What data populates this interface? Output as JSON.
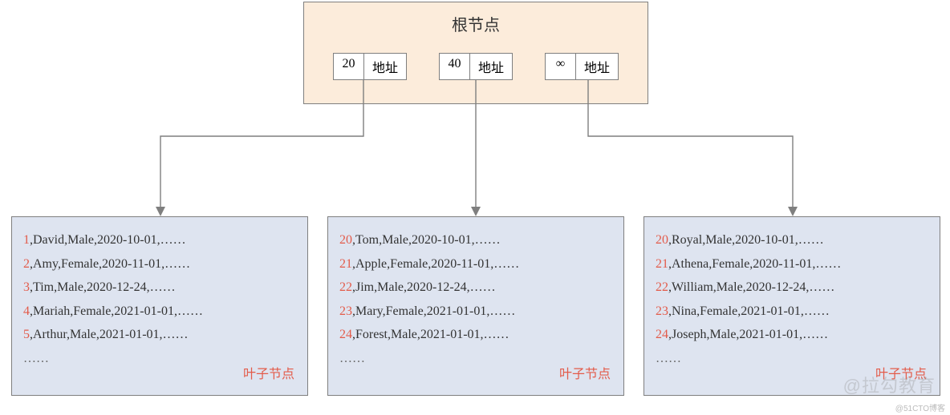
{
  "chart_data": {
    "type": "tree",
    "root": {
      "title": "根节点",
      "keys": [
        {
          "k": "20",
          "addr": "地址"
        },
        {
          "k": "40",
          "addr": "地址"
        },
        {
          "k": "∞",
          "addr": "地址"
        }
      ]
    },
    "leaves": [
      {
        "label": "叶子节点",
        "ellipsis": "……",
        "rows": [
          {
            "i": "1",
            "rest": ",David,Male,2020-10-01,……"
          },
          {
            "i": "2",
            "rest": ",Amy,Female,2020-11-01,……"
          },
          {
            "i": "3",
            "rest": ",Tim,Male,2020-12-24,……"
          },
          {
            "i": "4",
            "rest": ",Mariah,Female,2021-01-01,……"
          },
          {
            "i": "5",
            "rest": ",Arthur,Male,2021-01-01,……"
          }
        ]
      },
      {
        "label": "叶子节点",
        "ellipsis": "……",
        "rows": [
          {
            "i": "20",
            "rest": ",Tom,Male,2020-10-01,……"
          },
          {
            "i": "21",
            "rest": ",Apple,Female,2020-11-01,……"
          },
          {
            "i": "22",
            "rest": ",Jim,Male,2020-12-24,……"
          },
          {
            "i": "23",
            "rest": ",Mary,Female,2021-01-01,……"
          },
          {
            "i": "24",
            "rest": ",Forest,Male,2021-01-01,……"
          }
        ]
      },
      {
        "label": "叶子节点",
        "ellipsis": "……",
        "rows": [
          {
            "i": "20",
            "rest": ",Royal,Male,2020-10-01,……"
          },
          {
            "i": "21",
            "rest": ",Athena,Female,2020-11-01,……"
          },
          {
            "i": "22",
            "rest": ",William,Male,2020-12-24,……"
          },
          {
            "i": "23",
            "rest": ",Nina,Female,2021-01-01,……"
          },
          {
            "i": "24",
            "rest": ",Joseph,Male,2021-01-01,……"
          }
        ]
      }
    ]
  },
  "watermark_blog": "@51CTO博客",
  "watermark_brand": "@拉勾教育"
}
